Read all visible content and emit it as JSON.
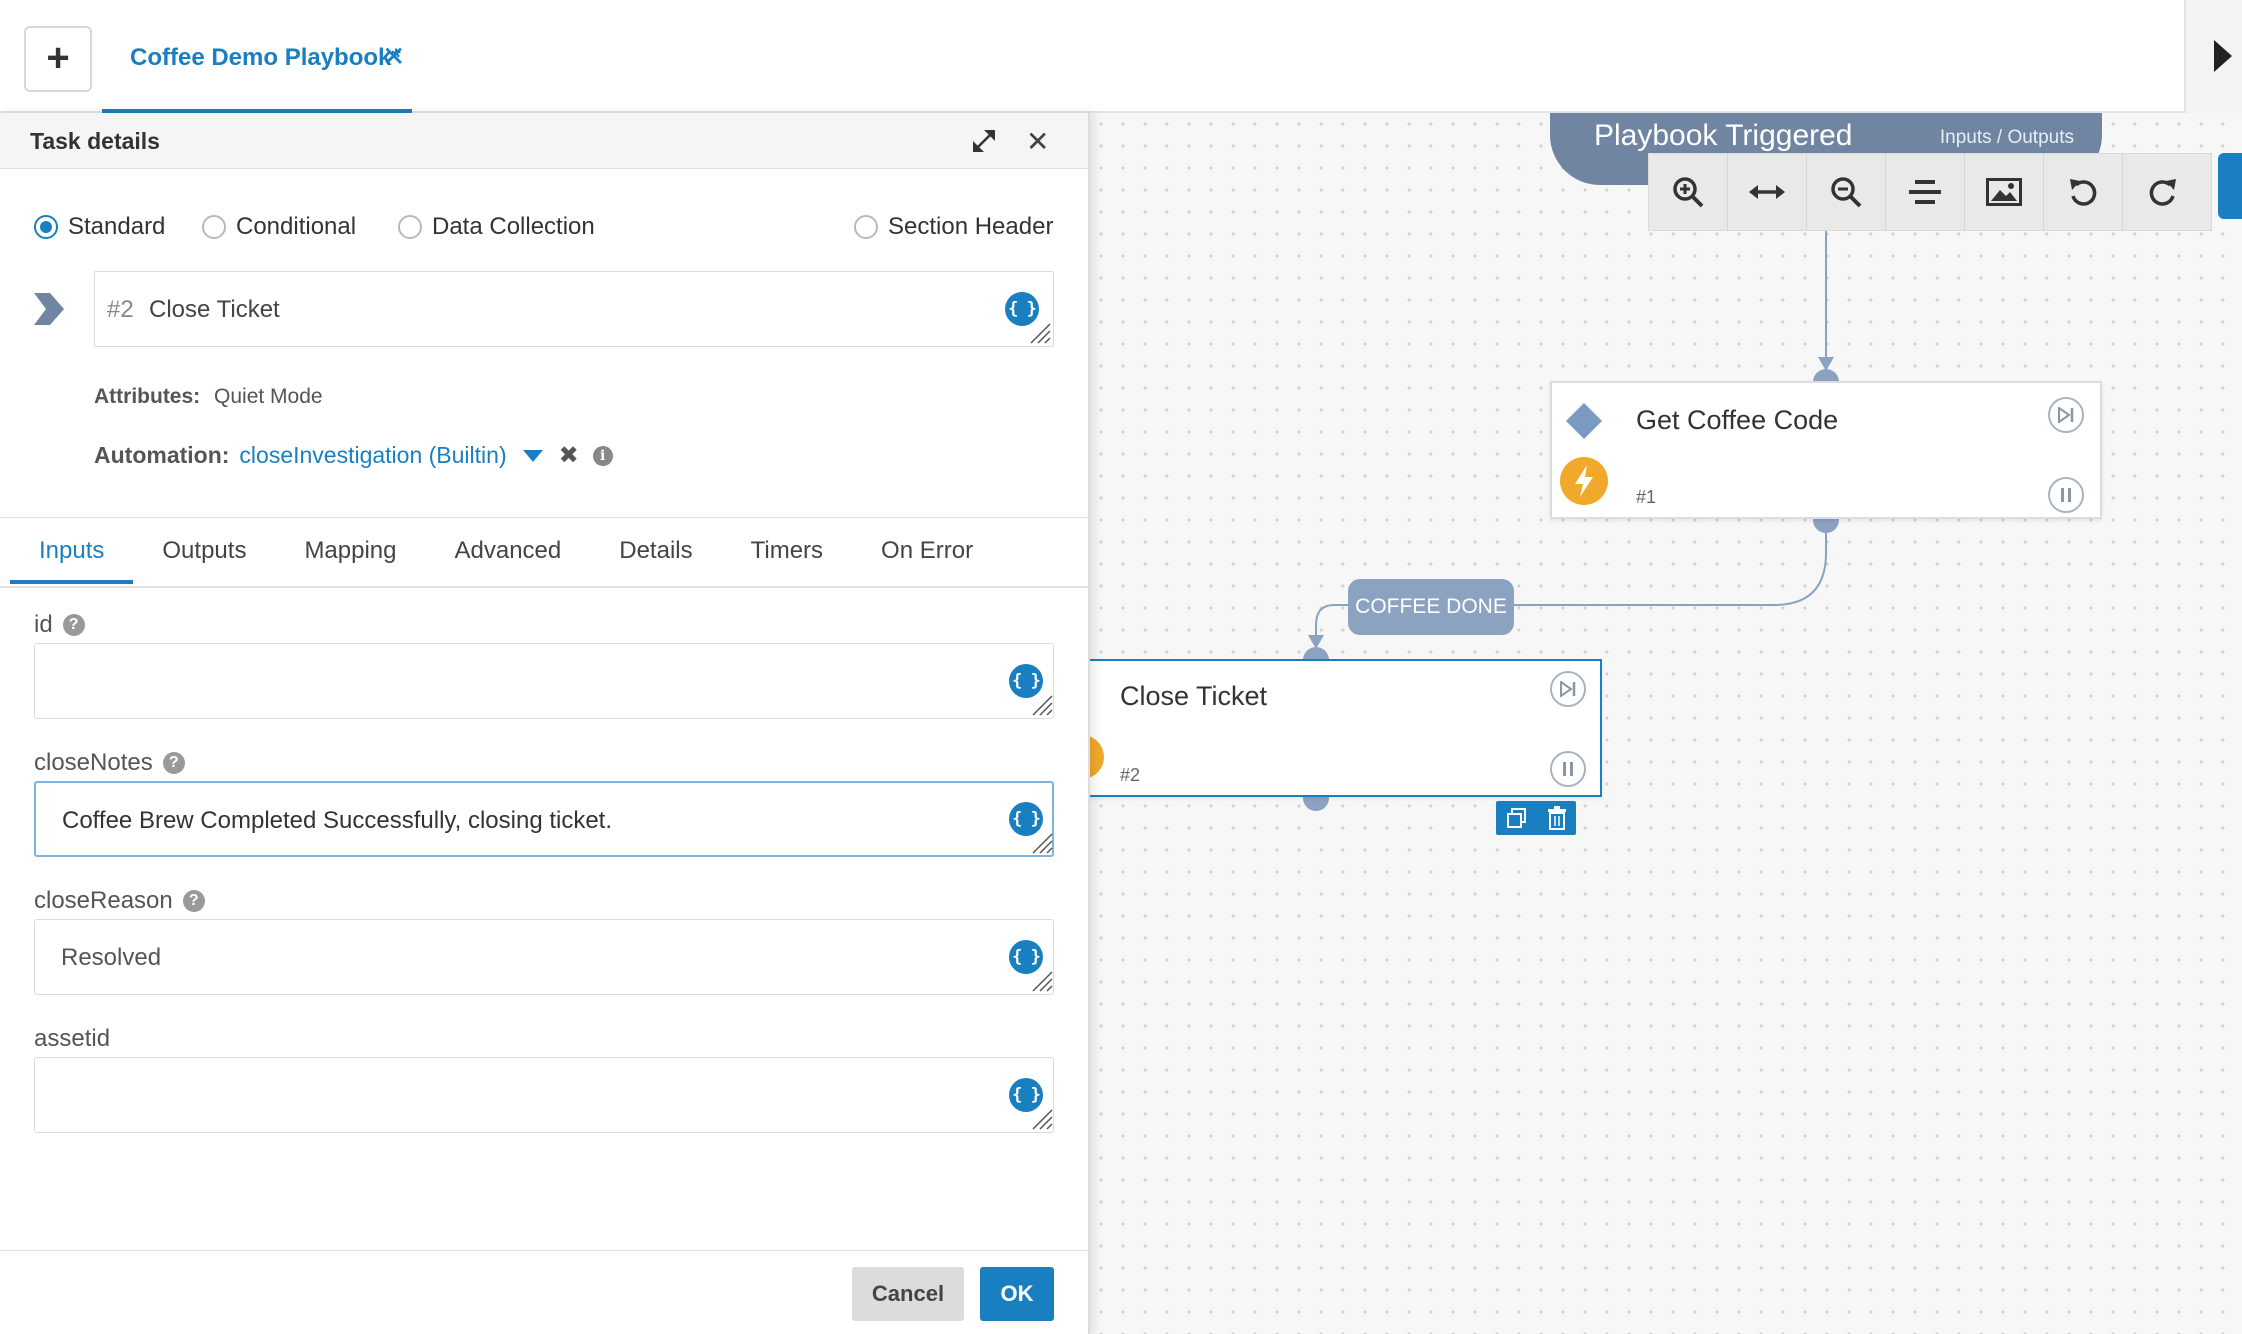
{
  "header": {
    "add_button": "+",
    "playbook_tab": "Coffee Demo Playbook*",
    "tab_close": "✕"
  },
  "canvas": {
    "trigger": {
      "title": "Playbook Triggered",
      "io_link": "Inputs / Outputs"
    },
    "toolbar": [
      "zoom-in-icon",
      "fit-width-icon",
      "zoom-out-icon",
      "align-icon",
      "image-export-icon",
      "undo-icon",
      "redo-icon"
    ],
    "nodes": [
      {
        "title": "Get Coffee Code",
        "number": "#1"
      },
      {
        "title": "Close Ticket",
        "number": "#2"
      }
    ],
    "edge_label": "COFFEE DONE",
    "colors": {
      "node_port": "#8ba3c0",
      "trigger": "#6f85a2",
      "accent": "#1a7fc1",
      "automation_bolt": "#f0a92a"
    }
  },
  "panel": {
    "title": "Task details",
    "close": "✕",
    "task_types": [
      {
        "label": "Standard",
        "checked": true
      },
      {
        "label": "Conditional",
        "checked": false
      },
      {
        "label": "Data Collection",
        "checked": false
      },
      {
        "label": "Section Header",
        "checked": false
      }
    ],
    "task": {
      "number": "#2",
      "name": "Close Ticket"
    },
    "attributes": {
      "label": "Attributes:",
      "value": "Quiet Mode"
    },
    "automation": {
      "label": "Automation:",
      "value": "closeInvestigation (Builtin)",
      "remove": "✖",
      "info": "i"
    },
    "tabs": [
      {
        "label": "Inputs",
        "active": true
      },
      {
        "label": "Outputs",
        "active": false
      },
      {
        "label": "Mapping",
        "active": false
      },
      {
        "label": "Advanced",
        "active": false
      },
      {
        "label": "Details",
        "active": false
      },
      {
        "label": "Timers",
        "active": false
      },
      {
        "label": "On Error",
        "active": false
      }
    ],
    "inputs": [
      {
        "label": "id",
        "help": "?",
        "value": ""
      },
      {
        "label": "closeNotes",
        "help": "?",
        "value": "Coffee Brew Completed Successfully, closing ticket."
      },
      {
        "label": "closeReason",
        "help": "?",
        "value": "Resolved"
      },
      {
        "label": "assetid",
        "help": "",
        "value": ""
      }
    ],
    "brace_icon": "{ }",
    "footer": {
      "cancel": "Cancel",
      "ok": "OK"
    }
  }
}
